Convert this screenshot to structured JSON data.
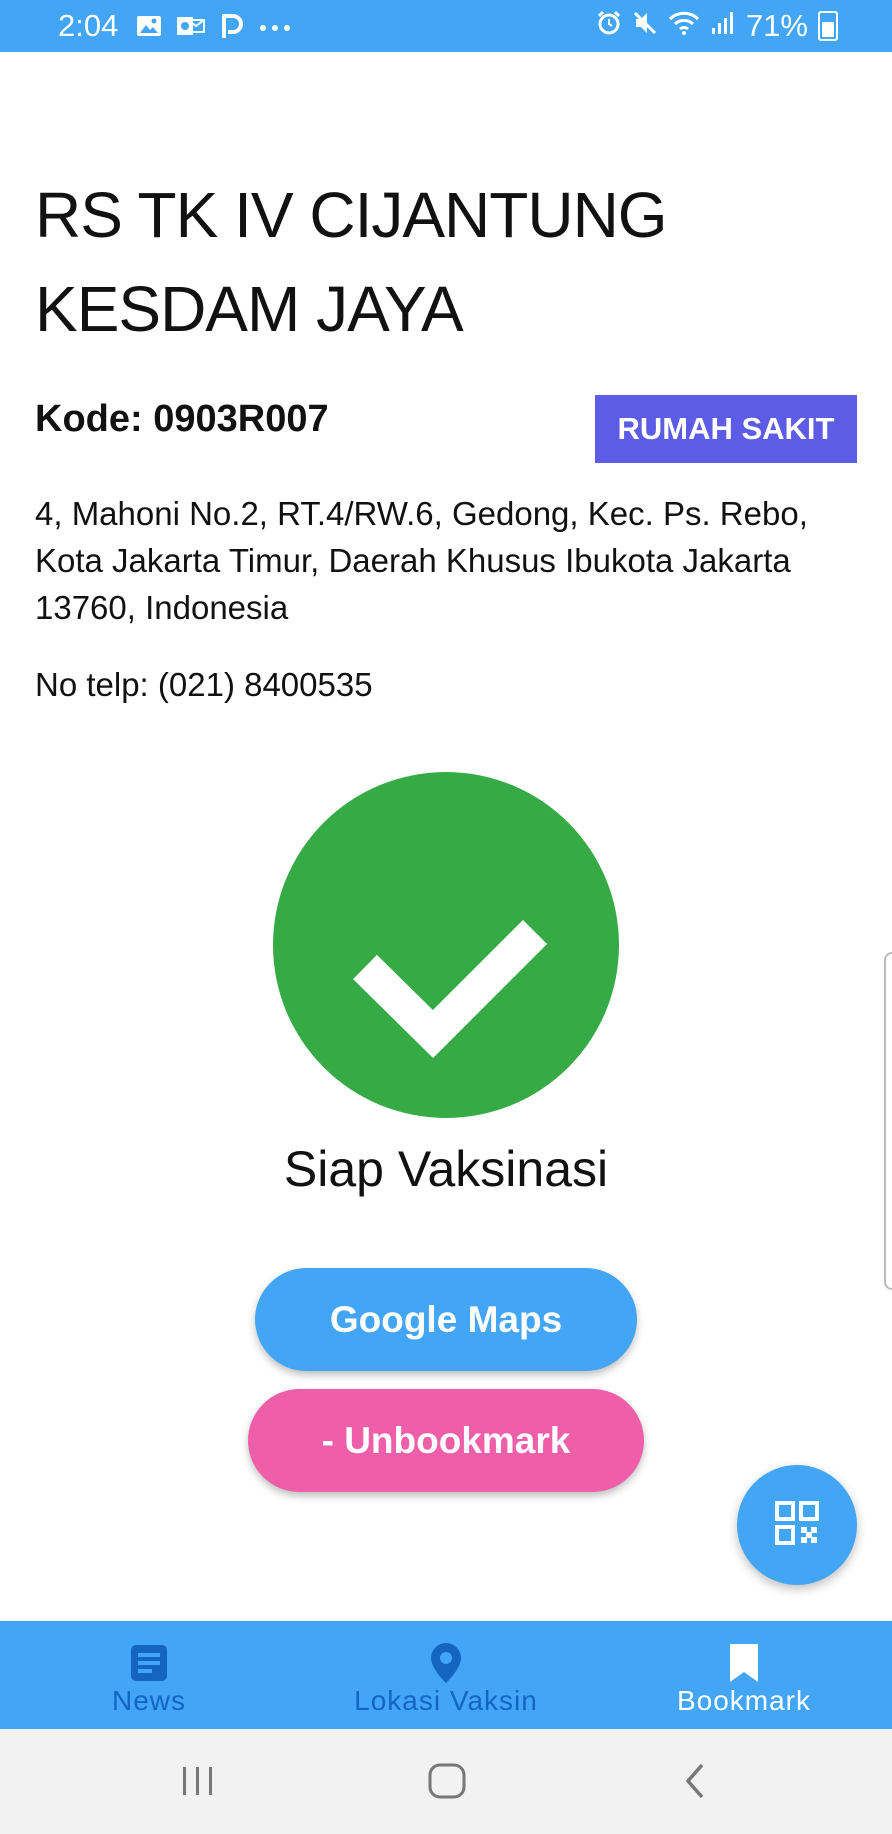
{
  "status_bar": {
    "time": "2:04",
    "left_icons": [
      "image-icon",
      "outlook-icon",
      "parking-icon",
      "more-dots-icon"
    ],
    "right_icons": [
      "alarm-icon",
      "mute-icon",
      "wifi-icon",
      "signal-icon",
      "battery-icon"
    ],
    "battery": "71%"
  },
  "facility": {
    "name": "RS TK IV CIJANTUNG KESDAM JAYA",
    "kode": "Kode: 0903R007",
    "type": "RUMAH SAKIT",
    "address": "4, Mahoni No.2, RT.4/RW.6, Gedong, Kec. Ps. Rebo, Kota Jakarta Timur, Daerah Khusus Ibukota Jakarta 13760, Indonesia",
    "phone": "No telp: (021) 8400535"
  },
  "vaccination_status": {
    "icon": "check-circle-icon",
    "label": "Siap Vaksinasi",
    "color": "#36aa45"
  },
  "actions": {
    "maps_label": "Google Maps",
    "unbookmark_label": "- Unbookmark",
    "fab_icon": "qr-code-icon"
  },
  "bottom_nav": {
    "items": [
      {
        "label": "News",
        "icon": "news-icon",
        "active": false
      },
      {
        "label": "Lokasi Vaksin",
        "icon": "location-pin-icon",
        "active": false
      },
      {
        "label": "Bookmark",
        "icon": "bookmark-icon",
        "active": true
      }
    ]
  },
  "system_nav": {
    "icons": [
      "recent-apps-icon",
      "home-icon",
      "back-icon"
    ]
  },
  "colors": {
    "primary": "#42a5f5",
    "badge": "#5c5ce6",
    "unbookmark": "#ef5ea8",
    "nav_inactive": "#1565c0",
    "nav_active": "#ffffff"
  }
}
